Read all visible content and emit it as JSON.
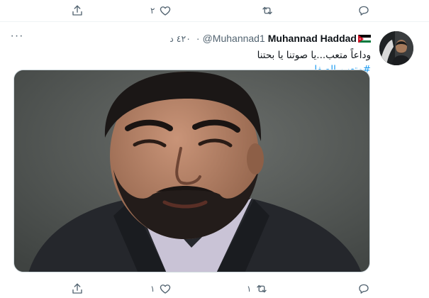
{
  "previous_tweet_actions": {
    "reply_count": "",
    "retweet_count": "",
    "like_count": "٢",
    "share_label": ""
  },
  "tweet": {
    "display_name": "Muhannad Haddad",
    "handle": "@Muhannad1",
    "time": "٤٢٠ د",
    "dot": "·",
    "text_line": "وداعاً متعب...يا صوتنا يا بحتنا",
    "hashtag": "#متعب_الصفار",
    "more_label": "···",
    "actions": {
      "reply_count": "",
      "retweet_count": "١",
      "like_count": "١"
    }
  },
  "icons": {
    "reply": "reply-icon",
    "retweet": "retweet-icon",
    "like": "heart-icon",
    "share": "share-icon",
    "more": "more-icon",
    "flag": "jordan-flag-icon"
  },
  "colors": {
    "link": "#1d9bf0",
    "muted": "#536471",
    "text": "#0f1419"
  }
}
